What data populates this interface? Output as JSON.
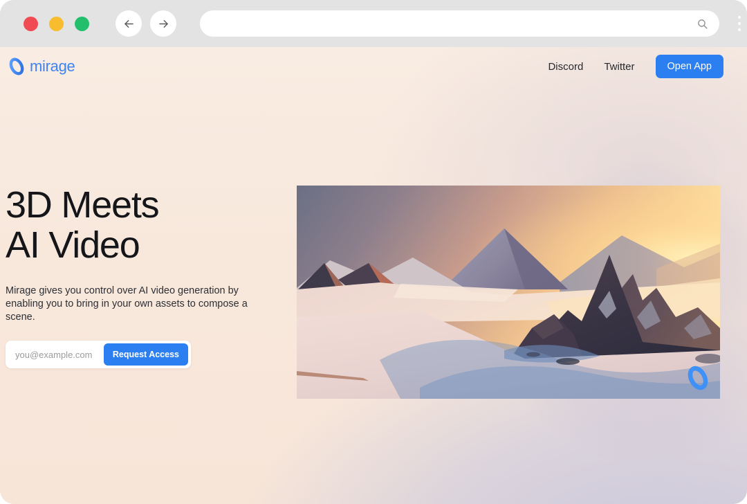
{
  "browser": {
    "traffic_lights": [
      "close",
      "minimize",
      "maximize"
    ],
    "back_label": "Back",
    "forward_label": "Forward",
    "url_value": "",
    "url_placeholder": "",
    "search_icon": "search-icon",
    "menu_icon": "kebab-menu-icon",
    "colors": {
      "chrome": "#e3e3e3",
      "red": "#f04a52",
      "yellow": "#f7bd2e",
      "green": "#23bf6d"
    }
  },
  "site": {
    "brand": {
      "name": "mirage",
      "logo_icon": "mirage-ring-logo-icon",
      "color": "#3f83f2"
    },
    "nav": [
      {
        "label": "Discord",
        "name": "nav-link-discord"
      },
      {
        "label": "Twitter",
        "name": "nav-link-twitter"
      }
    ],
    "cta": {
      "label": "Open App",
      "color": "#2b7ff0"
    }
  },
  "hero": {
    "headline_line1": "3D Meets",
    "headline_line2": "AI Video",
    "subtitle": "Mirage gives you control over AI video generation by enabling you to bring in your own assets to compose a scene.",
    "form": {
      "email_value": "",
      "email_placeholder": "you@example.com",
      "submit_label": "Request Access",
      "submit_color": "#2b7ff0"
    },
    "media": {
      "alt": "Snowy mountain landscape at sunset",
      "watermark_icon": "mirage-ring-logo-icon"
    }
  },
  "theme": {
    "page_background": "#f7e7dc",
    "text_primary": "#15161a",
    "accent": "#2b7ff0"
  }
}
